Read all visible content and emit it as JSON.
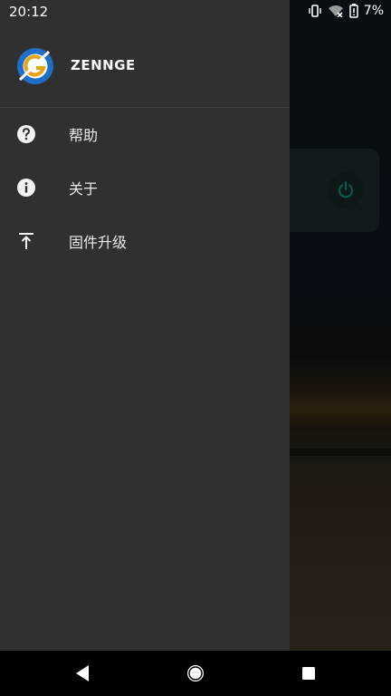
{
  "status_bar": {
    "time": "20:12",
    "battery": "7%"
  },
  "drawer": {
    "brand": "ZENNGE",
    "items": [
      {
        "label": "帮助",
        "icon": "help-icon"
      },
      {
        "label": "关于",
        "icon": "info-icon"
      },
      {
        "label": "固件升级",
        "icon": "upload-icon"
      }
    ]
  },
  "colors": {
    "drawer_bg": "#303030",
    "logo_blue": "#1f6fc9",
    "logo_gold": "#e6a417",
    "power_accent": "#1a9c8a"
  }
}
